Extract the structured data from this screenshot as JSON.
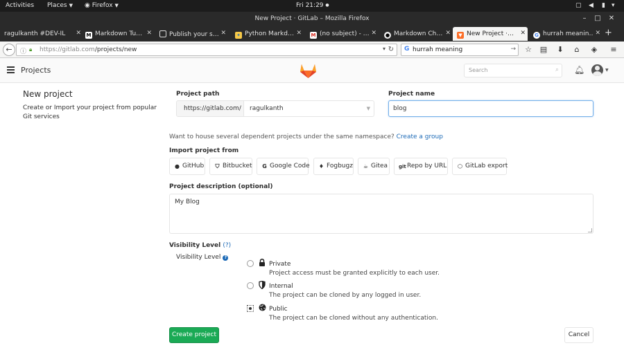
{
  "system_bar": {
    "activities": "Activities",
    "places": "Places",
    "app": "Firefox",
    "clock": "Fri 21:29"
  },
  "window": {
    "title": "New Project · GitLab – Mozilla Firefox"
  },
  "tabs": [
    {
      "label": "ragulkanth #DEV-IL",
      "icon": "dev-icon",
      "active": false
    },
    {
      "label": "Markdown Tu…",
      "icon": "markdown-icon",
      "active": false
    },
    {
      "label": "Publish your s…",
      "icon": "page-icon",
      "active": false
    },
    {
      "label": "Python Markd…",
      "icon": "python-icon",
      "active": false
    },
    {
      "label": "(no subject) - …",
      "icon": "gmail-icon",
      "active": false
    },
    {
      "label": "Markdown Ch…",
      "icon": "github-icon",
      "active": false
    },
    {
      "label": "New Project ·…",
      "icon": "gitlab-icon",
      "active": true
    },
    {
      "label": "hurrah meanin…",
      "icon": "google-icon",
      "active": false
    }
  ],
  "navbar": {
    "url_base": "https://gitlab.com",
    "url_path": "/projects/new",
    "search_value": "hurrah meaning"
  },
  "gitlab_header": {
    "title": "Projects",
    "search_placeholder": "Search"
  },
  "sidebar": {
    "title": "New project",
    "description": "Create or Import your project from popular Git services"
  },
  "form": {
    "project_path_label": "Project path",
    "path_prefix": "https://gitlab.com/",
    "namespace": "ragulkanth",
    "project_name_label": "Project name",
    "project_name_value": "blog",
    "house_text": "Want to house several dependent projects under the same namespace?",
    "create_group_link": "Create a group",
    "import_label": "Import project from",
    "import_sources": [
      {
        "label": "GitHub",
        "icon": "github-icon"
      },
      {
        "label": "Bitbucket",
        "icon": "bitbucket-icon"
      },
      {
        "label": "Google Code",
        "icon": "google-icon"
      },
      {
        "label": "Fogbugz",
        "icon": "fogbugz-icon"
      },
      {
        "label": "Gitea",
        "icon": "gitea-icon"
      },
      {
        "label": "Repo by URL",
        "icon": "git-icon"
      },
      {
        "label": "GitLab export",
        "icon": "gitlab-icon"
      }
    ],
    "description_label": "Project description (optional)",
    "description_value": "My Blog",
    "visibility_heading": "Visibility Level",
    "visibility_help": "(?)",
    "visibility_sublabel": "Visibility Level",
    "visibility_options": [
      {
        "name": "Private",
        "desc": "Project access must be granted explicitly to each user.",
        "icon": "lock-icon",
        "selected": false
      },
      {
        "name": "Internal",
        "desc": "The project can be cloned by any logged in user.",
        "icon": "shield-icon",
        "selected": false
      },
      {
        "name": "Public",
        "desc": "The project can be cloned without any authentication.",
        "icon": "globe-icon",
        "selected": true
      }
    ],
    "create_button": "Create project",
    "cancel_button": "Cancel"
  },
  "colors": {
    "accent_green": "#1aaa55",
    "link_blue": "#1b69b6",
    "gitlab_orange": "#fc6d26"
  }
}
